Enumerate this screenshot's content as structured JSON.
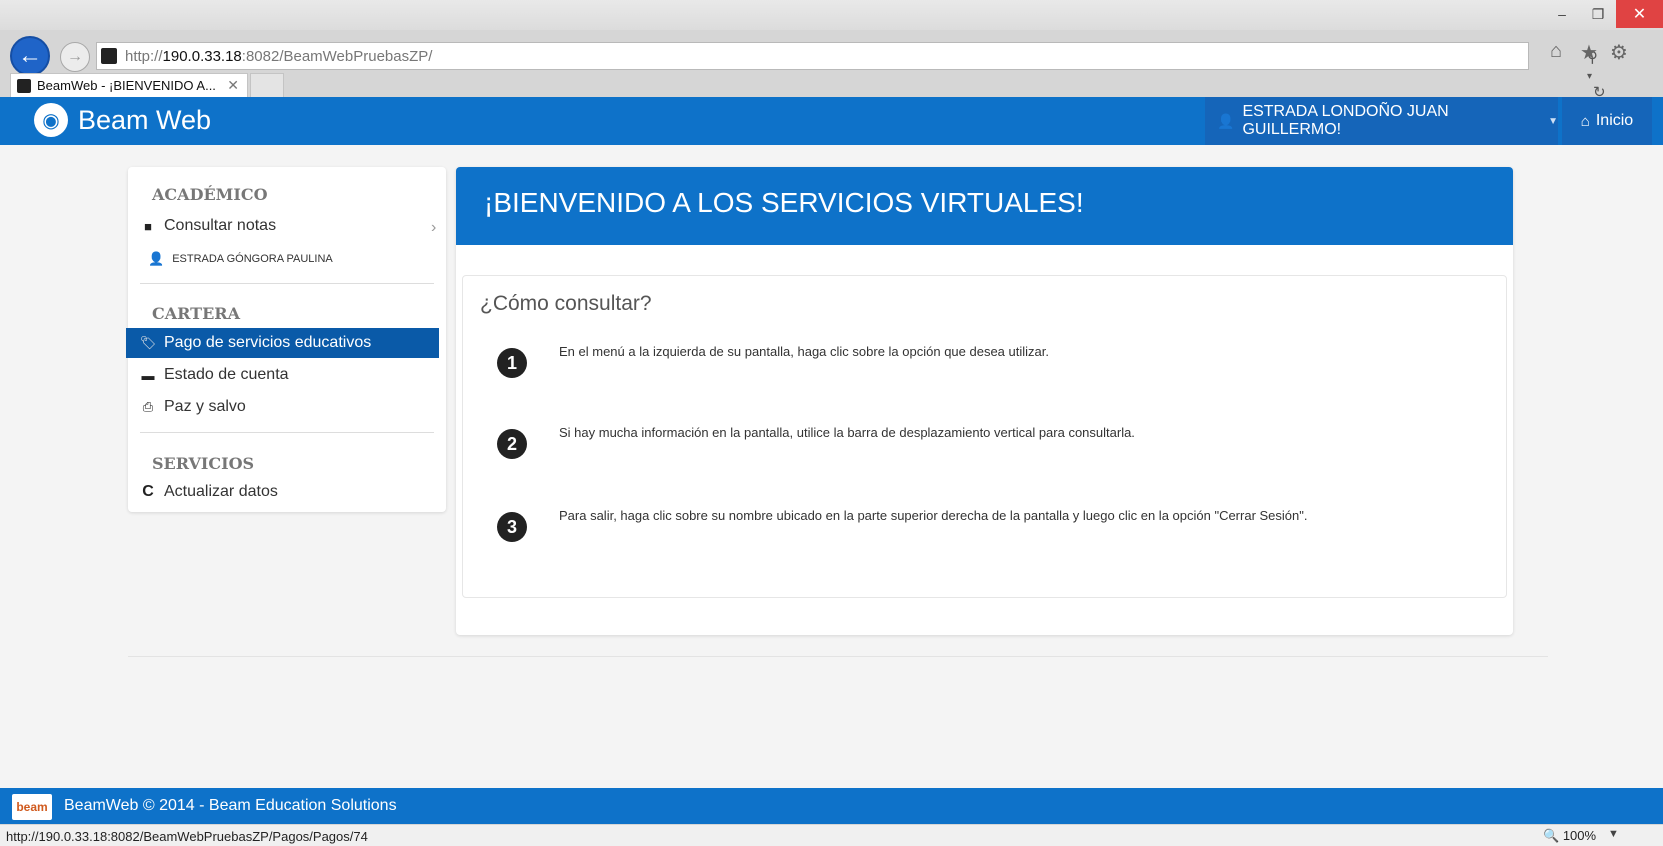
{
  "browser": {
    "address_prefix": "http://",
    "address_host": "190.0.33.18",
    "address_rest": ":8082/BeamWebPruebasZP/",
    "tab_title": "BeamWeb - ¡BIENVENIDO A...",
    "status_url": "http://190.0.33.18:8082/BeamWebPruebasZP/Pagos/Pagos/74",
    "zoom": "100%",
    "icons": [
      "back-icon",
      "forward-icon",
      "search-icon",
      "refresh-icon",
      "home-icon",
      "favorites-icon",
      "settings-icon"
    ]
  },
  "navbar": {
    "brand": "Beam Web",
    "user": "ESTRADA LONDOÑO JUAN GUILLERMO!",
    "home": "Inicio"
  },
  "sidebar": {
    "academico": {
      "heading": "ACADÉMICO",
      "items": [
        {
          "label": "Consultar notas",
          "icon": "book-icon"
        }
      ],
      "student": "ESTRADA GÓNGORA PAULINA"
    },
    "cartera": {
      "heading": "CARTERA",
      "items": [
        {
          "label": "Pago de servicios educativos",
          "icon": "tag-icon",
          "active": true
        },
        {
          "label": "Estado de cuenta",
          "icon": "folder-icon"
        },
        {
          "label": "Paz y salvo",
          "icon": "print-icon"
        }
      ]
    },
    "servicios": {
      "heading": "SERVICIOS",
      "items": [
        {
          "label": "Actualizar datos",
          "icon": "refresh-icon"
        }
      ]
    }
  },
  "main": {
    "title": "¡BIENVENIDO A LOS SERVICIOS VIRTUALES!",
    "card_title": "¿Cómo consultar?",
    "steps": [
      {
        "num": "1",
        "text": "En el menú a la izquierda de su pantalla, haga clic sobre la opción que desea utilizar."
      },
      {
        "num": "2",
        "text": "Si hay mucha información en la pantalla, utilice la barra de desplazamiento vertical para consultarla."
      },
      {
        "num": "3",
        "text": "Para salir, haga clic sobre su nombre ubicado en la parte superior derecha de la pantalla y luego clic en la opción \"Cerrar Sesión\"."
      }
    ]
  },
  "footer": {
    "logo": "beam",
    "text": "BeamWeb © 2014 - Beam Education Solutions"
  },
  "colors": {
    "primary": "#0e72c9",
    "active_item": "#0a5aa8",
    "background": "#f4f4f4"
  }
}
